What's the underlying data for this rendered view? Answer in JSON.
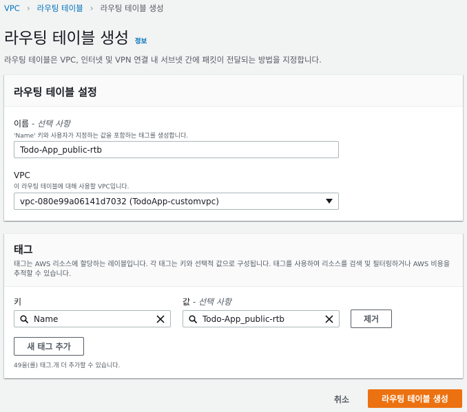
{
  "breadcrumb": {
    "items": [
      "VPC",
      "라우팅 테이블",
      "라우팅 테이블 생성"
    ]
  },
  "page": {
    "title": "라우팅 테이블 생성",
    "info_label": "정보",
    "description": "라우팅 테이블은 VPC, 인터넷 및 VPN 연결 내 서브넷 간에 패킷이 전달되는 방법을 지정합니다."
  },
  "settings": {
    "title": "라우팅 테이블 설정",
    "name_label": "이름",
    "name_optional": " - 선택 사항",
    "name_desc": "'Name' 키와 사용자가 지정하는 값을 포함하는 태그를 생성합니다.",
    "name_value": "Todo-App_public-rtb",
    "vpc_label": "VPC",
    "vpc_desc": "이 라우팅 테이블에 대해 사용할 VPC입니다.",
    "vpc_value": "vpc-080e99a06141d7032 (TodoApp-customvpc)"
  },
  "tags": {
    "title": "태그",
    "description": "태그는 AWS 리소스에 할당하는 레이블입니다. 각 태그는 키와 선택적 값으로 구성됩니다. 태그를 사용하여 리소스를 검색 및 필터링하거나 AWS 비용을 추적할 수 있습니다.",
    "key_label": "키",
    "value_label": "값",
    "value_optional": " - 선택 사항",
    "key_value": "Name",
    "value_value": "Todo-App_public-rtb",
    "remove_label": "제거",
    "add_label": "새 태그 추가",
    "limit_text": "49을(를) 태그.개 더 추가할 수 있습니다."
  },
  "footer": {
    "cancel_label": "취소",
    "create_label": "라우팅 테이블 생성"
  },
  "colors": {
    "link": "#0073bb",
    "primary": "#ec7211",
    "background": "#f2f3f3"
  }
}
